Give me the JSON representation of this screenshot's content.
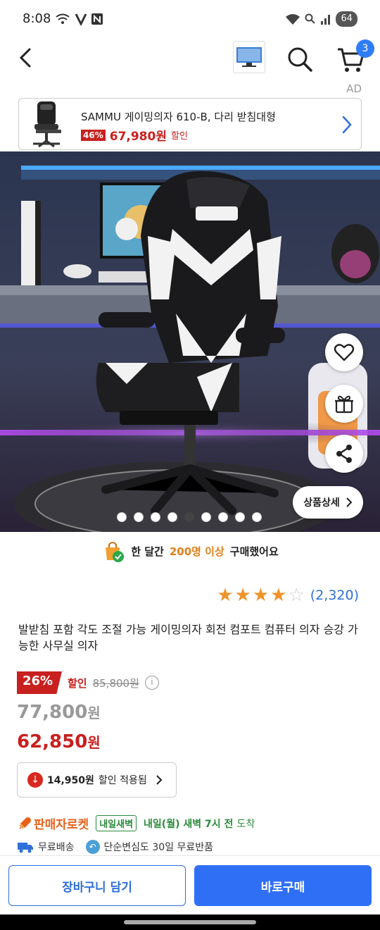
{
  "status_bar": {
    "time": "8:08",
    "battery": "64",
    "icons_left": [
      "wifi-calling-icon",
      "v-app-icon",
      "n-app-icon"
    ],
    "icons_right": [
      "wifi-icon",
      "search-icon",
      "signal-icon",
      "battery-icon"
    ]
  },
  "app_bar": {
    "cart_count": "3"
  },
  "ad": {
    "label": "AD",
    "title": "SAMMU 게이밍의자 610-B, 다리 받침대형",
    "discount_pct": "46%",
    "price": "67,980원",
    "discount_label": "할인"
  },
  "gallery": {
    "total_images": 9,
    "active_index": 4,
    "detail_button": "상품상세"
  },
  "buyers": {
    "prefix": "한 달간",
    "highlight": "200명 이상",
    "suffix": "구매했어요"
  },
  "rating": {
    "stars": 4,
    "max": 5,
    "count": "(2,320)"
  },
  "product": {
    "title": "발받침 포함 각도 조절 가능 게이밍의자 회전 컴포트 컴퓨터 의자 승강 가능한 사무실 의자",
    "discount_pct": "26%",
    "discount_label": "할인",
    "original_price": "85,800원",
    "sale_price": "77,800",
    "sale_price_unit": "원",
    "final_price": "62,850",
    "final_price_unit": "원"
  },
  "coupon": {
    "amount": "14,950원",
    "text": "할인 적용됨"
  },
  "delivery": {
    "brand": "판매자로켓",
    "badge": "내일새벽",
    "arrival": "내일(월) 새벽 7시 전",
    "arrival_suffix": "도착",
    "free_shipping": "무료배송",
    "return_policy": "단순변심도 30일 무료반품"
  },
  "actions": {
    "add_to_cart": "장바구니 담기",
    "buy_now": "바로구매"
  },
  "colors": {
    "accent_blue": "#2f6ff6",
    "sale_red": "#c8201e",
    "rocket_orange": "#e8601a",
    "dawn_green": "#2a8a3a",
    "star_orange": "#f0932b"
  }
}
